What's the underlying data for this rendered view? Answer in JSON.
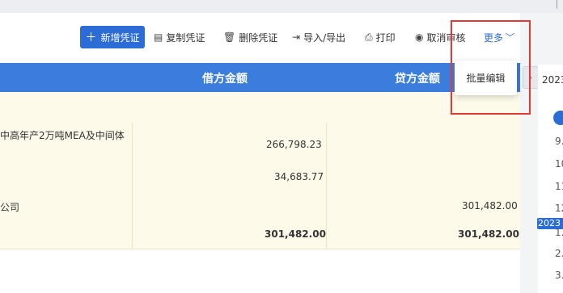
{
  "toolbar": {
    "add_label": "新增凭证",
    "copy_label": "复制凭证",
    "delete_label": "删除凭证",
    "import_export_label": "导入/导出",
    "print_label": "打印",
    "cancel_review_label": "取消审核",
    "more_label": "更多"
  },
  "dropdown": {
    "batch_edit_label": "批量编辑"
  },
  "table": {
    "headers": {
      "debit": "借方金额",
      "credit": "贷方金额"
    },
    "rows": [
      {
        "summary": "中高年产2万吨MEA及中间体",
        "debit": "266,798.23",
        "credit": ""
      },
      {
        "summary": "",
        "debit": "34,683.77",
        "credit": ""
      },
      {
        "summary": "公司",
        "debit": "",
        "credit": "301,482.00"
      }
    ],
    "total": {
      "debit": "301,482.00",
      "credit": "301,482.00"
    }
  },
  "calendar": {
    "year_label": "2023",
    "year_badge": "2023",
    "items": [
      "9.",
      "10",
      "11",
      "12",
      "1.",
      "2.",
      "3."
    ]
  },
  "icons": {
    "plus": "plus-icon",
    "copy": "copy-icon",
    "delete": "trash-icon",
    "import": "import-export-icon",
    "print": "printer-icon",
    "cancel": "cancel-review-icon",
    "more": "chevron-down-icon",
    "collapse": "chevron-right-icon"
  },
  "colors": {
    "primary": "#2c6cd6",
    "header": "#3b7ddd",
    "row_bg": "#fdfaea",
    "highlight": "#e53935"
  }
}
